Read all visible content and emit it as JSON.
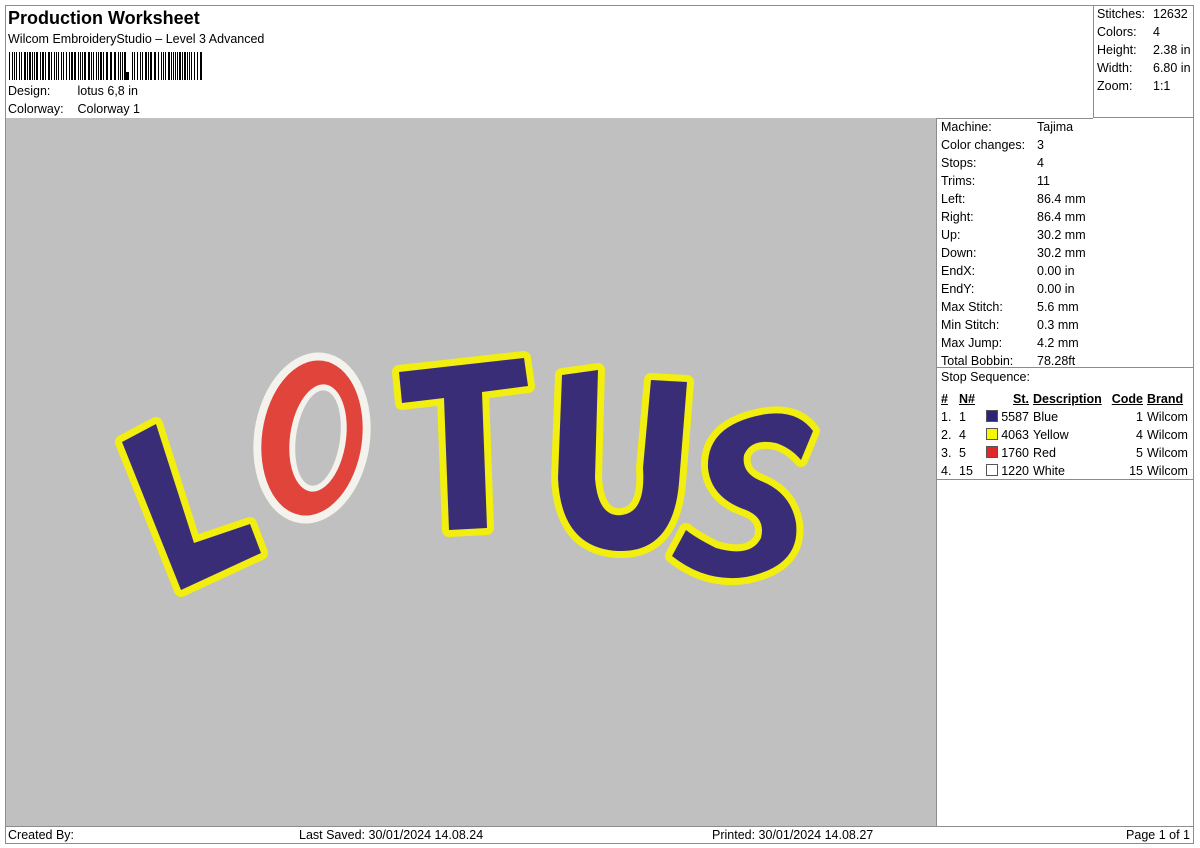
{
  "header": {
    "title": "Production Worksheet",
    "subtitle": "Wilcom EmbroideryStudio – Level 3 Advanced",
    "design_label": "Design:",
    "design_value": "lotus 6,8 in",
    "colorway_label": "Colorway:",
    "colorway_value": "Colorway 1"
  },
  "summary": [
    {
      "label": "Stitches:",
      "value": "12632"
    },
    {
      "label": "Colors:",
      "value": "4"
    },
    {
      "label": "Height:",
      "value": "2.38 in"
    },
    {
      "label": "Width:",
      "value": "6.80 in"
    },
    {
      "label": "Zoom:",
      "value": "1:1"
    }
  ],
  "machine_info": [
    {
      "label": "Machine:",
      "value": "Tajima"
    },
    {
      "label": "Color changes:",
      "value": "3"
    },
    {
      "label": "Stops:",
      "value": "4"
    },
    {
      "label": "Trims:",
      "value": "11"
    },
    {
      "label": "Left:",
      "value": "86.4 mm"
    },
    {
      "label": "Right:",
      "value": "86.4 mm"
    },
    {
      "label": "Up:",
      "value": "30.2 mm"
    },
    {
      "label": "Down:",
      "value": "30.2 mm"
    },
    {
      "label": "EndX:",
      "value": "0.00 in"
    },
    {
      "label": "EndY:",
      "value": "0.00 in"
    },
    {
      "label": "Max Stitch:",
      "value": "5.6 mm"
    },
    {
      "label": "Min Stitch:",
      "value": "0.3 mm"
    },
    {
      "label": "Max Jump:",
      "value": "4.2 mm"
    },
    {
      "label": "Total Bobbin:",
      "value": "78.28ft"
    }
  ],
  "stop_sequence": {
    "label": "Stop Sequence:",
    "columns": [
      "#",
      "N#",
      "St.",
      "Description",
      "Code",
      "Brand"
    ],
    "rows": [
      {
        "index": "1.",
        "n": "1",
        "color": "#2a2376",
        "st": "5587",
        "description": "Blue",
        "code": "1",
        "brand": "Wilcom"
      },
      {
        "index": "2.",
        "n": "4",
        "color": "#f7f700",
        "st": "4063",
        "description": "Yellow",
        "code": "4",
        "brand": "Wilcom"
      },
      {
        "index": "3.",
        "n": "5",
        "color": "#e02a2a",
        "st": "1760",
        "description": "Red",
        "code": "5",
        "brand": "Wilcom"
      },
      {
        "index": "4.",
        "n": "15",
        "color": "#ffffff",
        "st": "1220",
        "description": "White",
        "code": "15",
        "brand": "Wilcom"
      }
    ]
  },
  "design_colors": {
    "blue": "#3a2d78",
    "yellow": "#f2ee10",
    "red": "#e0443a",
    "white": "#f4f2ec",
    "background": "#c0c0c0"
  },
  "footer": {
    "created_by": "Created By:",
    "last_saved": "Last Saved: 30/01/2024 14.08.24",
    "printed": "Printed: 30/01/2024 14.08.27",
    "page": "Page 1 of 1"
  }
}
